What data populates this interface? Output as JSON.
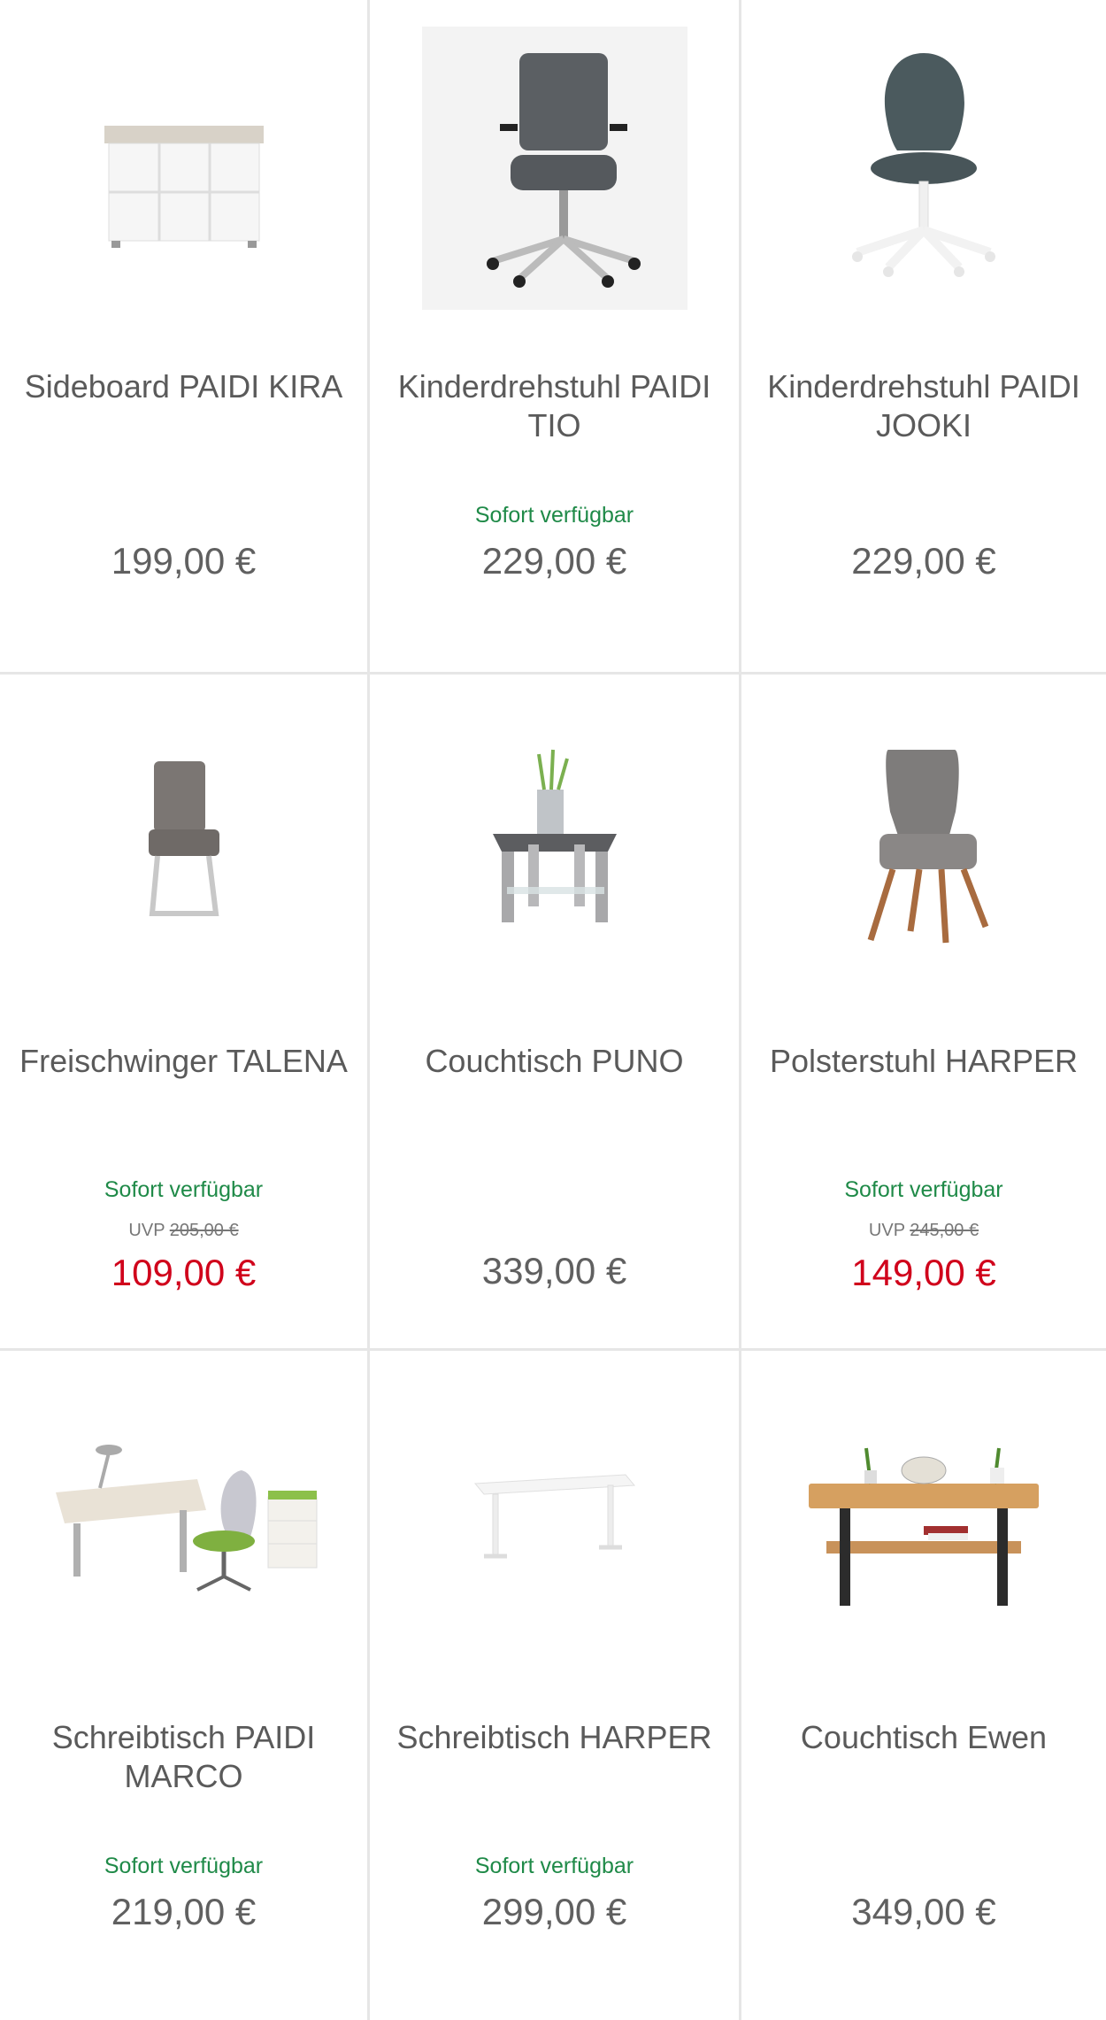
{
  "products": [
    {
      "name": "Sideboard PAIDI KIRA",
      "availability": "",
      "uvp_label": "",
      "uvp_old": "",
      "price": "199,00 €",
      "icon": "sideboard-image"
    },
    {
      "name": "Kinderdrehstuhl PAIDI TIO",
      "availability": "Sofort verfügbar",
      "uvp_label": "",
      "uvp_old": "",
      "price": "229,00 €",
      "icon": "office-chair-image"
    },
    {
      "name": "Kinderdrehstuhl PAIDI JOOKI",
      "availability": "",
      "uvp_label": "",
      "uvp_old": "",
      "price": "229,00 €",
      "icon": "kids-chair-image"
    },
    {
      "name": "Freischwinger TALENA",
      "availability": "Sofort verfügbar",
      "uvp_label": "UVP",
      "uvp_old": "205,00 €",
      "price": "109,00 €",
      "icon": "cantilever-chair-image"
    },
    {
      "name": "Couchtisch PUNO",
      "availability": "",
      "uvp_label": "",
      "uvp_old": "",
      "price": "339,00 €",
      "icon": "glass-coffee-table-image"
    },
    {
      "name": "Polsterstuhl HARPER",
      "availability": "Sofort verfügbar",
      "uvp_label": "UVP",
      "uvp_old": "245,00 €",
      "price": "149,00 €",
      "icon": "upholstered-chair-image"
    },
    {
      "name": "Schreibtisch PAIDI MARCO",
      "availability": "Sofort verfügbar",
      "uvp_label": "",
      "uvp_old": "",
      "price": "219,00 €",
      "icon": "kids-desk-set-image"
    },
    {
      "name": "Schreibtisch HARPER",
      "availability": "Sofort verfügbar",
      "uvp_label": "",
      "uvp_old": "",
      "price": "299,00 €",
      "icon": "standing-desk-image"
    },
    {
      "name": "Couchtisch Ewen",
      "availability": "",
      "uvp_label": "",
      "uvp_old": "",
      "price": "349,00 €",
      "icon": "wood-coffee-table-image"
    }
  ],
  "colors": {
    "availability": "#1f8a48",
    "sale_price": "#d0021b",
    "regular_price": "#606060",
    "divider": "#e6e6e6"
  }
}
